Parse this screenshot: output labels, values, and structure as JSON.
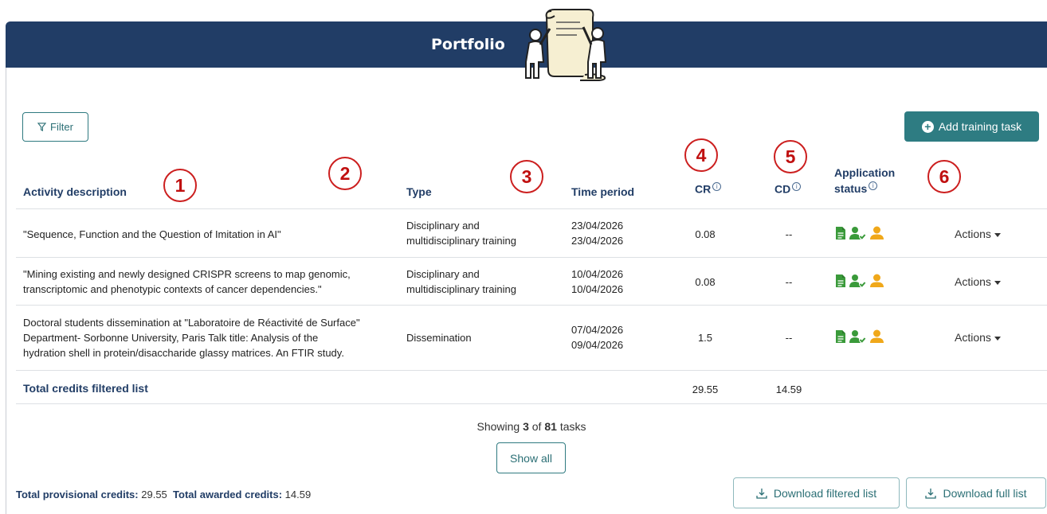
{
  "header": {
    "title": "Portfolio"
  },
  "toolbar": {
    "filter_label": "Filter",
    "add_label": "Add training task"
  },
  "callouts": [
    "1",
    "2",
    "3",
    "4",
    "5",
    "6"
  ],
  "columns": {
    "activity": "Activity description",
    "type": "Type",
    "time": "Time period",
    "cr": "CR",
    "cd": "CD",
    "status_line1": "Application",
    "status_line2": "status"
  },
  "rows": [
    {
      "activity": [
        "\"Sequence, Function and the Question of Imitation in AI\""
      ],
      "type": [
        "Disciplinary and",
        "multidisciplinary training"
      ],
      "start": "23/04/2026",
      "end": "23/04/2026",
      "cr": "0.08",
      "cd": "--",
      "actions": "Actions"
    },
    {
      "activity": [
        "\"Mining existing and newly designed CRISPR screens to map genomic,",
        "transcriptomic and phenotypic contexts of cancer dependencies.\""
      ],
      "type": [
        "Disciplinary and",
        "multidisciplinary training"
      ],
      "start": "10/04/2026",
      "end": "10/04/2026",
      "cr": "0.08",
      "cd": "--",
      "actions": "Actions"
    },
    {
      "activity": [
        "Doctoral students dissemination at \"Laboratoire de Réactivité de Surface\"",
        "Department- Sorbonne University, Paris Talk title: Analysis of the",
        "hydration shell in protein/disaccharide glassy matrices. An FTIR study."
      ],
      "type": [
        "Dissemination"
      ],
      "start": "07/04/2026",
      "end": "09/04/2026",
      "cr": "1.5",
      "cd": "--",
      "actions": "Actions"
    }
  ],
  "totals_row": {
    "label": "Total credits filtered list",
    "cr": "29.55",
    "cd": "14.59"
  },
  "pagination": {
    "prefix": "Showing",
    "shown": "3",
    "of": "of",
    "total": "81",
    "suffix": "tasks",
    "show_all": "Show all"
  },
  "footer": {
    "provisional_label": "Total provisional credits:",
    "provisional_value": "29.55",
    "awarded_label": "Total awarded credits:",
    "awarded_value": "14.59",
    "download_filtered": "Download filtered list",
    "download_full": "Download full list"
  },
  "icons": {
    "filter": "filter-icon",
    "add": "plus-circle-icon",
    "info": "info-icon",
    "document": "document-icon",
    "user_check": "user-check-icon",
    "user": "user-icon",
    "download": "download-icon"
  },
  "colors": {
    "header": "#213d66",
    "accent": "#2e7c82",
    "callout": "#cc1f1f",
    "status_green": "#3a9a3a",
    "status_orange": "#f0a81a"
  }
}
